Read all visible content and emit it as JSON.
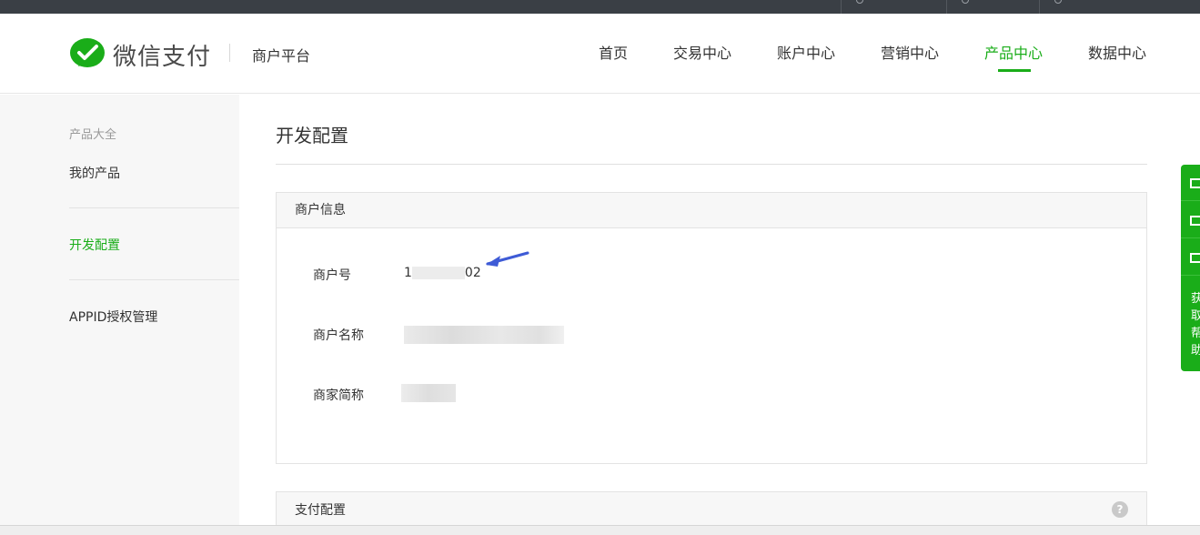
{
  "brand": {
    "name": "微信支付",
    "sub": "商户平台"
  },
  "nav": [
    "首页",
    "交易中心",
    "账户中心",
    "营销中心",
    "产品中心",
    "数据中心"
  ],
  "sidebar": {
    "group": "产品大全",
    "items": [
      "我的产品",
      "开发配置",
      "APPID授权管理"
    ]
  },
  "page": {
    "title": "开发配置"
  },
  "merchant_card": {
    "title": "商户信息",
    "rows": [
      {
        "label": "商户号",
        "value_start": "1",
        "value_end": "02"
      },
      {
        "label": "商户名称"
      },
      {
        "label": "商家简称"
      }
    ]
  },
  "pay_card": {
    "title": "支付配置",
    "help": "?"
  },
  "float_bar": {
    "text": "获取帮助"
  },
  "colors": {
    "accent": "#1aad19",
    "arrow": "#3e5bd6"
  }
}
